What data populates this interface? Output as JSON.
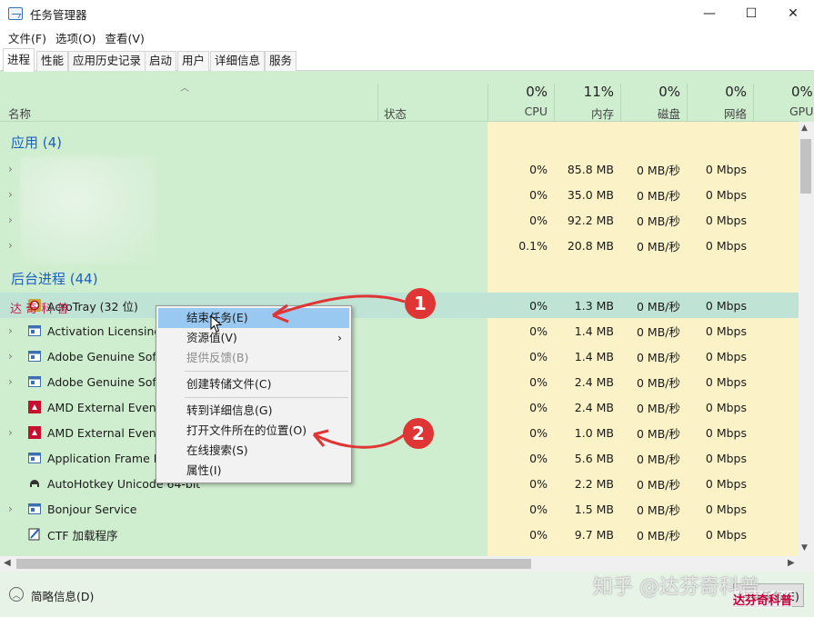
{
  "window": {
    "title": "任务管理器",
    "minimize": "—",
    "maximize": "☐",
    "close": "✕"
  },
  "menu": [
    "文件(F)",
    "选项(O)",
    "查看(V)"
  ],
  "tabs": [
    "进程",
    "性能",
    "应用历史记录",
    "启动",
    "用户",
    "详细信息",
    "服务"
  ],
  "header": {
    "name": "名称",
    "status": "状态",
    "cpu_pct": "0%",
    "cpu": "CPU",
    "mem_pct": "11%",
    "mem": "内存",
    "disk_pct": "0%",
    "disk": "磁盘",
    "net_pct": "0%",
    "net": "网络",
    "gpu_pct": "0%",
    "gpu": "GPU"
  },
  "groups": {
    "apps": "应用 (4)",
    "background": "后台进程 (44)"
  },
  "apps": [
    {
      "cpu": "0%",
      "mem": "85.8 MB",
      "disk": "0 MB/秒",
      "net": "0 Mbps"
    },
    {
      "cpu": "0%",
      "mem": "35.0 MB",
      "disk": "0 MB/秒",
      "net": "0 Mbps"
    },
    {
      "cpu": "0%",
      "mem": "92.2 MB",
      "disk": "0 MB/秒",
      "net": "0 Mbps"
    },
    {
      "cpu": "0.1%",
      "mem": "20.8 MB",
      "disk": "0 MB/秒",
      "net": "0 Mbps"
    }
  ],
  "processes": [
    {
      "name": "AcroTray (32 位)",
      "cpu": "0%",
      "mem": "1.3 MB",
      "disk": "0 MB/秒",
      "net": "0 Mbps"
    },
    {
      "name": "Activation Licensing",
      "cpu": "0%",
      "mem": "1.4 MB",
      "disk": "0 MB/秒",
      "net": "0 Mbps"
    },
    {
      "name": "Adobe Genuine Soft",
      "cpu": "0%",
      "mem": "1.4 MB",
      "disk": "0 MB/秒",
      "net": "0 Mbps"
    },
    {
      "name": "Adobe Genuine Soft",
      "cpu": "0%",
      "mem": "2.4 MB",
      "disk": "0 MB/秒",
      "net": "0 Mbps"
    },
    {
      "name": "AMD External Events",
      "cpu": "0%",
      "mem": "2.4 MB",
      "disk": "0 MB/秒",
      "net": "0 Mbps"
    },
    {
      "name": "AMD External Events",
      "cpu": "0%",
      "mem": "1.0 MB",
      "disk": "0 MB/秒",
      "net": "0 Mbps"
    },
    {
      "name": "Application Frame H",
      "cpu": "0%",
      "mem": "5.6 MB",
      "disk": "0 MB/秒",
      "net": "0 Mbps"
    },
    {
      "name": "AutoHotkey Unicode 64-bit",
      "cpu": "0%",
      "mem": "2.2 MB",
      "disk": "0 MB/秒",
      "net": "0 Mbps"
    },
    {
      "name": "Bonjour Service",
      "cpu": "0%",
      "mem": "1.5 MB",
      "disk": "0 MB/秒",
      "net": "0 Mbps"
    },
    {
      "name": "CTF 加载程序",
      "cpu": "0%",
      "mem": "9.7 MB",
      "disk": "0 MB/秒",
      "net": "0 Mbps"
    }
  ],
  "context_menu": [
    "结束任务(E)",
    "资源值(V)",
    "提供反馈(B)",
    "创建转储文件(C)",
    "转到详细信息(G)",
    "打开文件所在的位置(O)",
    "在线搜索(S)",
    "属性(I)"
  ],
  "footer": {
    "fewer_details": "简略信息(D)",
    "end_task": "结束任务(E)"
  },
  "annotations": {
    "badge1": "1",
    "badge2": "2",
    "watermark": "知乎 @达芬奇科普",
    "stamp": "达芬奇科普",
    "stamp_row": "达 奇 科 普"
  },
  "colors": {
    "selected_row": "#bfe3d4",
    "menu_highlight": "#99c9f1",
    "group_text": "#1f5fbf",
    "badge": "#e03535",
    "heat": "#fbf2c7"
  }
}
